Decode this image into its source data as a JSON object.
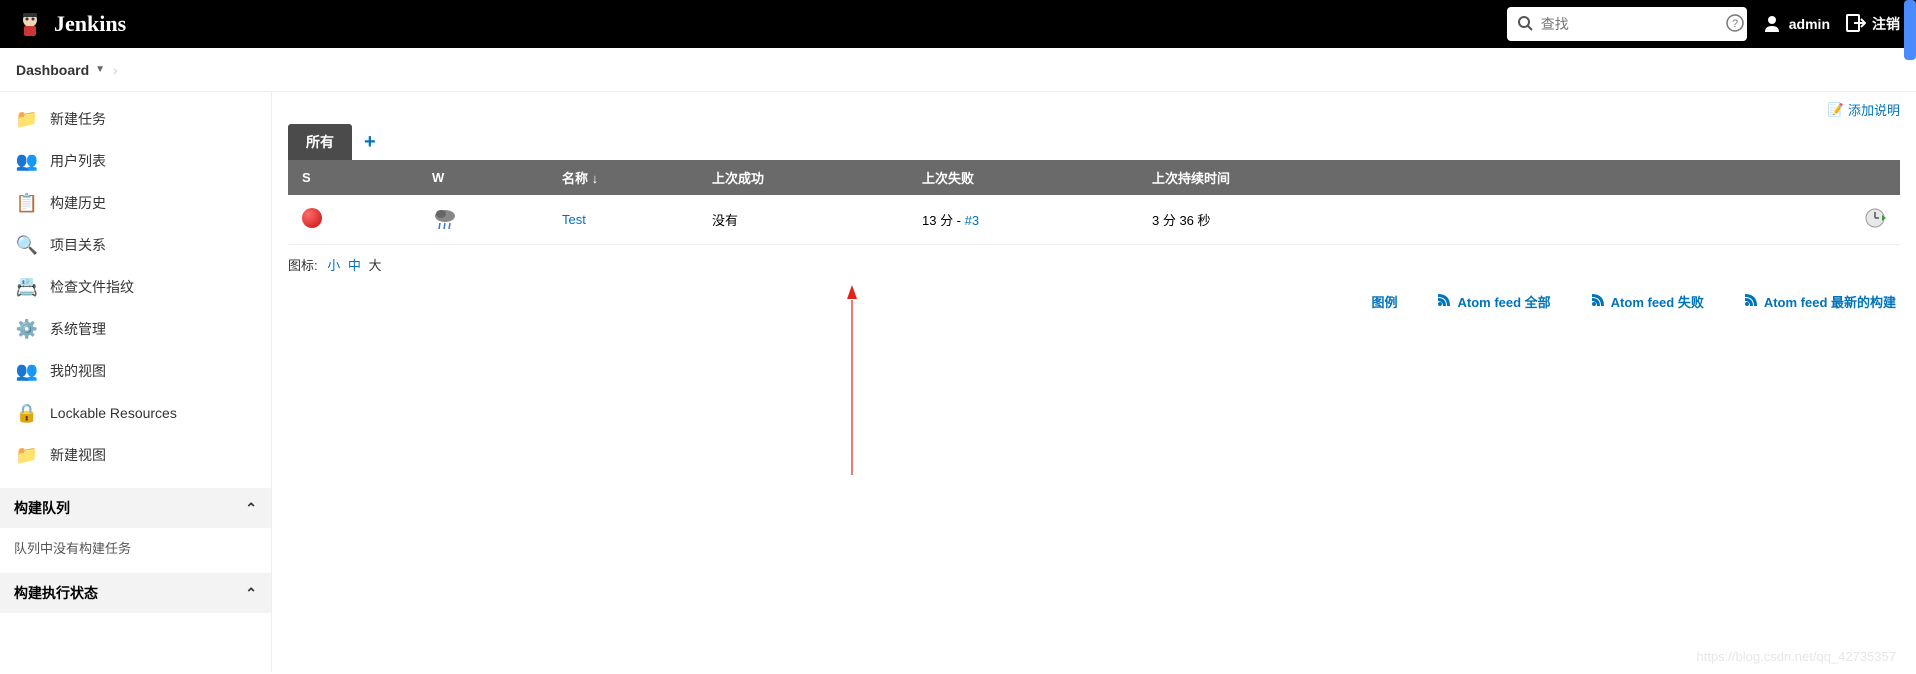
{
  "header": {
    "logo_text": "Jenkins",
    "search_placeholder": "查找",
    "user": "admin",
    "logout": "注销"
  },
  "breadcrumbs": {
    "items": [
      "Dashboard"
    ]
  },
  "sidebar": {
    "items": [
      {
        "label": "新建任务",
        "icon": "📁",
        "color": "#d4a84a"
      },
      {
        "label": "用户列表",
        "icon": "👥",
        "color": "#3b79c2"
      },
      {
        "label": "构建历史",
        "icon": "📋",
        "color": "#999"
      },
      {
        "label": "项目关系",
        "icon": "🔍",
        "color": "#999"
      },
      {
        "label": "检查文件指纹",
        "icon": "📇",
        "color": "#999"
      },
      {
        "label": "系统管理",
        "icon": "⚙️",
        "color": "#999"
      },
      {
        "label": "我的视图",
        "icon": "👥",
        "color": "#3b79c2"
      },
      {
        "label": "Lockable Resources",
        "icon": "🔒",
        "color": "#777"
      },
      {
        "label": "新建视图",
        "icon": "📁",
        "color": "#5a8cba"
      }
    ],
    "queue_section": "构建队列",
    "queue_empty": "队列中没有构建任务",
    "executor_section": "构建执行状态"
  },
  "content": {
    "add_desc": "添加说明",
    "tabs": {
      "active": "所有"
    },
    "columns": {
      "status": "S",
      "weather": "W",
      "name": "名称 ↓",
      "last_success": "上次成功",
      "last_failure": "上次失败",
      "duration": "上次持续时间"
    },
    "rows": [
      {
        "name": "Test",
        "last_success": "没有",
        "last_failure_time": "13 分 - ",
        "last_failure_build": "#3",
        "duration": "3 分 36 秒"
      }
    ],
    "icon_size": {
      "label": "图标:",
      "small": "小",
      "medium": "中",
      "large": "大"
    },
    "footer": {
      "legend": "图例",
      "atom_all": "Atom feed 全部",
      "atom_fail": "Atom feed 失败",
      "atom_latest": "Atom feed 最新的构建"
    }
  },
  "watermark": "https://blog.csdn.net/qq_42735357"
}
